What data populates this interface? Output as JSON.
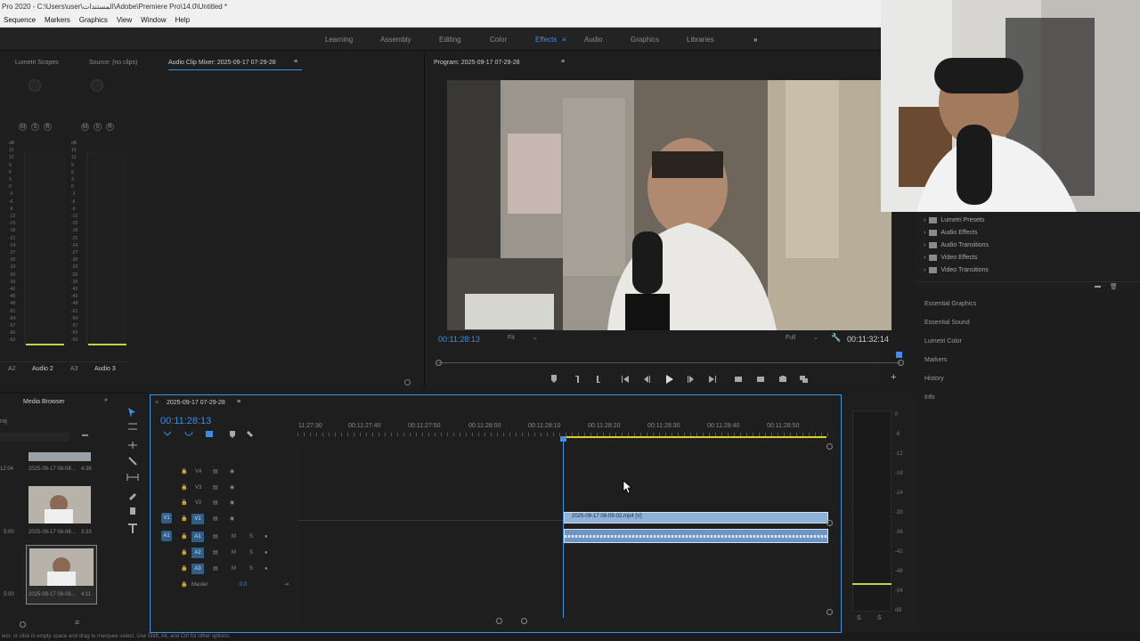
{
  "titlebar": {
    "text": "Pro 2020 - C:\\Users\\user\\المستندات\\Adobe\\Premiere Pro\\14.0\\Untitled *"
  },
  "menu": [
    "Sequence",
    "Markers",
    "Graphics",
    "View",
    "Window",
    "Help"
  ],
  "workspaces": [
    {
      "label": "Learning",
      "active": false
    },
    {
      "label": "Assembly",
      "active": false
    },
    {
      "label": "Editing",
      "active": false
    },
    {
      "label": "Color",
      "active": false
    },
    {
      "label": "Effects",
      "active": true
    },
    {
      "label": "Audio",
      "active": false
    },
    {
      "label": "Graphics",
      "active": false
    },
    {
      "label": "Libraries",
      "active": false
    }
  ],
  "source_panel": {
    "tabs": [
      "Lumetri Scopes",
      "Source: (no clips)",
      "Audio Clip Mixer: 2025-09-17 07-29-28"
    ],
    "mixer_buttons": [
      "M",
      "S",
      "R"
    ],
    "channel_labels": [
      "A2",
      "Audio 2",
      "A3",
      "Audio 3"
    ],
    "db_scale": [
      "dB",
      "15",
      "12",
      "9",
      "6",
      "3",
      "0",
      "-3",
      "-6",
      "-9",
      "-12",
      "-15",
      "-18",
      "-21",
      "-24",
      "-27",
      "-30",
      "-33",
      "-36",
      "-39",
      "-42",
      "-45",
      "-48",
      "-51",
      "-54",
      "-57",
      "-60",
      "-63"
    ]
  },
  "program": {
    "title": "Program: 2025-09-17 07-29-28",
    "current_time": "00:11:28:13",
    "fit": "Fit",
    "quality": "Full",
    "duration": "00:11:32:14"
  },
  "project": {
    "tab": "Media Browser",
    "proj_label": "roj",
    "clips": [
      {
        "name": "2025-09-17 08-08...",
        "dur": "4:36",
        "left": "12:04"
      },
      {
        "name": "2025-09-17 08-08...",
        "dur": "3:33",
        "left": "5:00"
      },
      {
        "name": "2025-09-17 08-08...",
        "dur": "4:11",
        "left": "5:00"
      }
    ]
  },
  "timeline": {
    "sequence": "2025-09-17 07-29-28",
    "timecode": "00:11:28:13",
    "ruler": [
      "11:27:30",
      "00:11:27:40",
      "00:11:27:50",
      "00:11:28:00",
      "00:11:28:10",
      "00:11:28:20",
      "00:11:28:30",
      "00:11:28:40",
      "00:11:28:50"
    ],
    "video_tracks": [
      "V4",
      "V3",
      "V2",
      "V1"
    ],
    "audio_tracks": [
      "A1",
      "A2",
      "A3"
    ],
    "source_v": "V1",
    "source_a": "A1",
    "master_label": "Master",
    "master_value": "0.0",
    "video_clip": "2025-09-17 08-09-02.mp4 [V]"
  },
  "effects": {
    "items": [
      "Lumetri Presets",
      "Audio Effects",
      "Audio Transitions",
      "Video Effects",
      "Video Transitions"
    ]
  },
  "right_panels": [
    "Essential Graphics",
    "Essential Sound",
    "Lumetri Color",
    "Markers",
    "History",
    "Info"
  ],
  "audio_meter": {
    "scale": [
      "0",
      "-6",
      "-12",
      "-18",
      "-24",
      "-30",
      "-36",
      "-42",
      "-48",
      "-54",
      "dB"
    ],
    "solo": [
      "S",
      "S"
    ]
  },
  "status": "lect, or click in empty space and drag to marquee select. Use Shift, Alt, and Ctrl for other options.",
  "colors": {
    "accent": "#3a8ee6",
    "bg": "#1d1d1d",
    "panel": "#1e1e1e",
    "clip_video": "#8fb1d8",
    "clip_audio": "#6f95c2",
    "playhead": "#3f8fe8"
  }
}
